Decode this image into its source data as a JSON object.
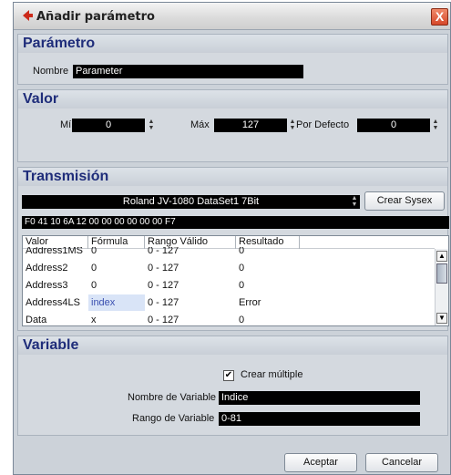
{
  "window": {
    "title": "Añadir parámetro",
    "close_glyph": "X"
  },
  "parametro": {
    "heading": "Parámetro",
    "nombre_label": "Nombre",
    "nombre_value": "Parameter"
  },
  "valor": {
    "heading": "Valor",
    "min_label": "Mín",
    "min_value": "0",
    "max_label": "Máx",
    "max_value": "127",
    "default_label": "Por Defecto",
    "default_value": "0"
  },
  "transmision": {
    "heading": "Transmisión",
    "device": "Roland JV-1080 DataSet1 7Bit",
    "crear_sysex_label": "Crear Sysex",
    "hex": "F0 41 10 6A 12 00 00 00 00 00 00 F7",
    "columns": [
      "Valor",
      "Fórmula",
      "Rango Válido",
      "Resultado"
    ],
    "rows": [
      {
        "valor": "Address1MS",
        "formula": "0",
        "rango": "0 - 127",
        "resultado": "0"
      },
      {
        "valor": "Address2",
        "formula": "0",
        "rango": "0 - 127",
        "resultado": "0"
      },
      {
        "valor": "Address3",
        "formula": "0",
        "rango": "0 - 127",
        "resultado": "0"
      },
      {
        "valor": "Address4LS",
        "formula": "index",
        "rango": "0 - 127",
        "resultado": "Error"
      },
      {
        "valor": "Data",
        "formula": "x",
        "rango": "0 - 127",
        "resultado": "0"
      }
    ]
  },
  "variable": {
    "heading": "Variable",
    "crear_multiple_label": "Crear múltiple",
    "crear_multiple_checked": true,
    "nombre_label": "Nombre de Variable",
    "nombre_value": "Indice",
    "rango_label": "Rango de Variable",
    "rango_value": "0-81"
  },
  "footer": {
    "aceptar_label": "Aceptar",
    "cancelar_label": "Cancelar"
  },
  "colors": {
    "heading": "#1f2d7a",
    "field_bg": "#000000",
    "panel": "#d4d9df",
    "close": "#d6482a"
  }
}
